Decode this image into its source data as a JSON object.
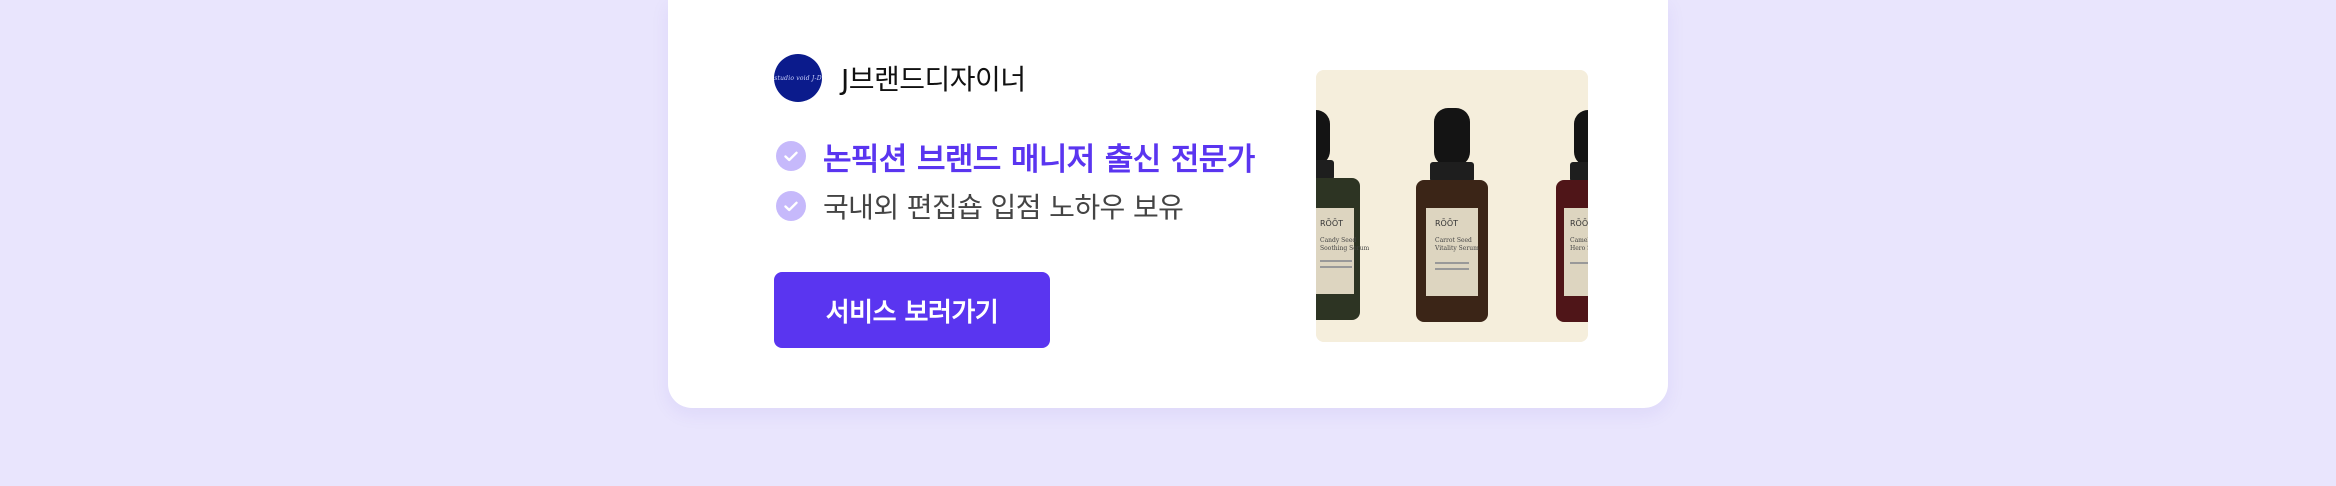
{
  "seller": {
    "avatar_text": "studio void J-D",
    "name": "J브랜드디자이너"
  },
  "features": [
    {
      "text": "논픽션 브랜드 매니저 출신 전문가",
      "icon": "check-icon"
    },
    {
      "text": "국내외 편집숍 입점 노하우 보유",
      "icon": "check-icon"
    }
  ],
  "cta": {
    "label": "서비스 보러가기"
  },
  "product_image": {
    "bottles": [
      {
        "brand": "RŌŌT",
        "line1": "Candy Seed",
        "line2": "Soothing Serum",
        "color": "#2d3423"
      },
      {
        "brand": "RŌŌT",
        "line1": "Carrot Seed",
        "line2": "Vitality Serum",
        "color": "#3b2517"
      },
      {
        "brand": "RŌŌT",
        "line1": "Camellia",
        "line2": "Hero Serum",
        "color": "#4f1518"
      }
    ]
  },
  "colors": {
    "page_background": "#e9e5fd",
    "accent": "#5a35f0",
    "check_badge": "#c6b9fb",
    "avatar": "#0b1b8c"
  }
}
